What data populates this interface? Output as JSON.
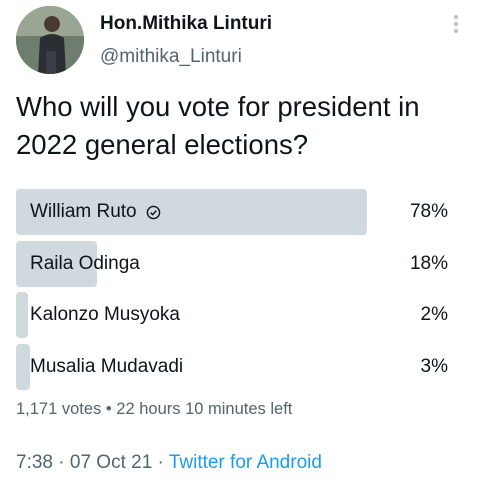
{
  "author": {
    "name": "Hon.Mithika Linturi",
    "handle": "@mithika_Linturi"
  },
  "tweet": {
    "text": "Who will you vote for president in 2022 general elections?"
  },
  "poll": {
    "options": [
      {
        "label": "William Ruto",
        "percent_text": "78%",
        "percent": 78,
        "winner": true
      },
      {
        "label": "Raila Odinga",
        "percent_text": "18%",
        "percent": 18,
        "winner": false
      },
      {
        "label": "Kalonzo Musyoka",
        "percent_text": "2%",
        "percent": 2,
        "winner": false
      },
      {
        "label": "Musalia Mudavadi",
        "percent_text": "3%",
        "percent": 3,
        "winner": false
      }
    ],
    "votes": "1,171 votes",
    "separator": "•",
    "time_left": "22 hours 10 minutes left"
  },
  "footer": {
    "time": "7:38",
    "dot": "·",
    "date": "07 Oct 21",
    "source": "Twitter for Android"
  },
  "colors": {
    "bar": "#cfd9de",
    "link": "#1d9bf0",
    "secondary_text": "#536471"
  },
  "icons": {
    "winner": "check-circle-icon",
    "more": "more-vertical-icon"
  }
}
